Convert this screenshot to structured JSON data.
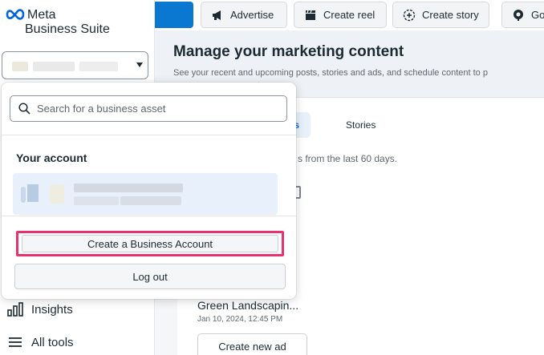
{
  "brand": {
    "line1": "Meta",
    "line2": "Business Suite",
    "color": "#0064e0"
  },
  "topbar": {
    "advertise": "Advertise",
    "create_reel": "Create reel",
    "create_story": "Create story",
    "go": "Go",
    "accent": "#0a78d1"
  },
  "header": {
    "title": "Manage your marketing content",
    "subtitle": "See your recent and upcoming posts, stories and ads, and schedule content to p"
  },
  "content": {
    "tab_reels": "reels",
    "tab_stories": "Stories",
    "hint": "s from the last 60 days.",
    "post_title": "Green Landscapin...",
    "post_date": "Jan 10, 2024, 12:45 PM",
    "create_ad": "Create new ad"
  },
  "sidebar": {
    "items": [
      {
        "label": "Insights",
        "icon": "bar-chart-icon"
      },
      {
        "label": "All tools",
        "icon": "menu-icon"
      }
    ]
  },
  "dropdown": {
    "search_placeholder": "Search for a business asset",
    "section_label": "Your account",
    "create_business": "Create a Business Account",
    "logout": "Log out",
    "highlight_color": "#e8326e"
  }
}
